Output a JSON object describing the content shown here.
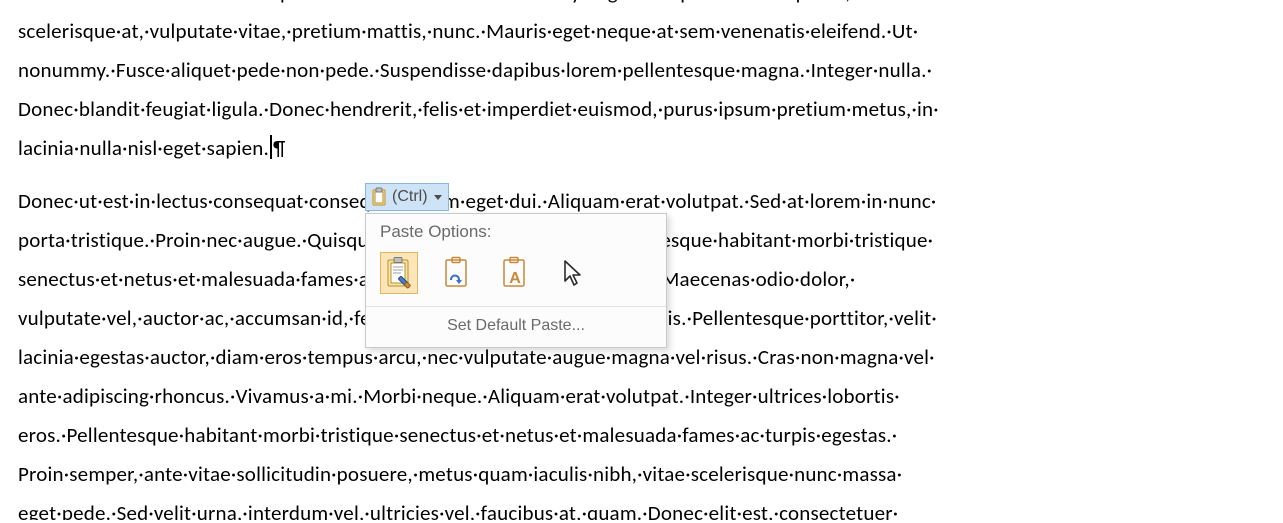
{
  "document": {
    "top_clip": "et·erat.·Aenean·nec·lorem.·In·porttitor.·Donec·laoreet·nonummy·augue.·Suspendisse·dui·purus,·",
    "para1_lines": [
      "scelerisque·at,·vulputate·vitae,·pretium·mattis,·nunc.·Mauris·eget·neque·at·sem·venenatis·eleifend.·Ut·",
      "nonummy.·Fusce·aliquet·pede·non·pede.·Suspendisse·dapibus·lorem·pellentesque·magna.·Integer·nulla.·",
      "Donec·blandit·feugiat·ligula.·Donec·hendrerit,·felis·et·imperdiet·euismod,·purus·ipsum·pretium·metus,·in·",
      "lacinia·nulla·nisl·eget·sapien."
    ],
    "pilcrow": "¶",
    "para2_lines": [
      "Donec·ut·est·in·lectus·consequat·consequat.·Etiam·eget·dui.·Aliquam·erat·volutpat.·Sed·at·lorem·in·nunc·",
      "porta·tristique.·Proin·nec·augue.·Quisque·aliquam·tempor·magna.·Pellentesque·habitant·morbi·tristique·",
      "senectus·et·netus·et·malesuada·fames·ac·turpis·egestas.·Nunc·ac·magna.·Maecenas·odio·dolor,·",
      "vulputate·vel,·auctor·ac,·accumsan·id,·felis.·Pellentesque·cursus·sagittis·felis.·Pellentesque·porttitor,·velit·",
      "lacinia·egestas·auctor,·diam·eros·tempus·arcu,·nec·vulputate·augue·magna·vel·risus.·Cras·non·magna·vel·",
      "ante·adipiscing·rhoncus.·Vivamus·a·mi.·Morbi·neque.·Aliquam·erat·volutpat.·Integer·ultrices·lobortis·",
      "eros.·Pellentesque·habitant·morbi·tristique·senectus·et·netus·et·malesuada·fames·ac·turpis·egestas.·",
      "Proin·semper,·ante·vitae·sollicitudin·posuere,·metus·quam·iaculis·nibh,·vitae·scelerisque·nunc·massa·"
    ],
    "bottom_clip": "eget·pede.·Sed·velit·urna,·interdum·vel,·ultricies·vel,·faucibus·at,·quam.·Donec·elit·est,·consectetuer·"
  },
  "paste_popup": {
    "ctrl_label": "(Ctrl)",
    "header": "Paste Options:",
    "options": [
      {
        "id": "keep-source-formatting",
        "selected": true
      },
      {
        "id": "merge-formatting",
        "selected": false
      },
      {
        "id": "keep-text-only",
        "selected": false
      }
    ],
    "set_default": "Set Default Paste..."
  }
}
